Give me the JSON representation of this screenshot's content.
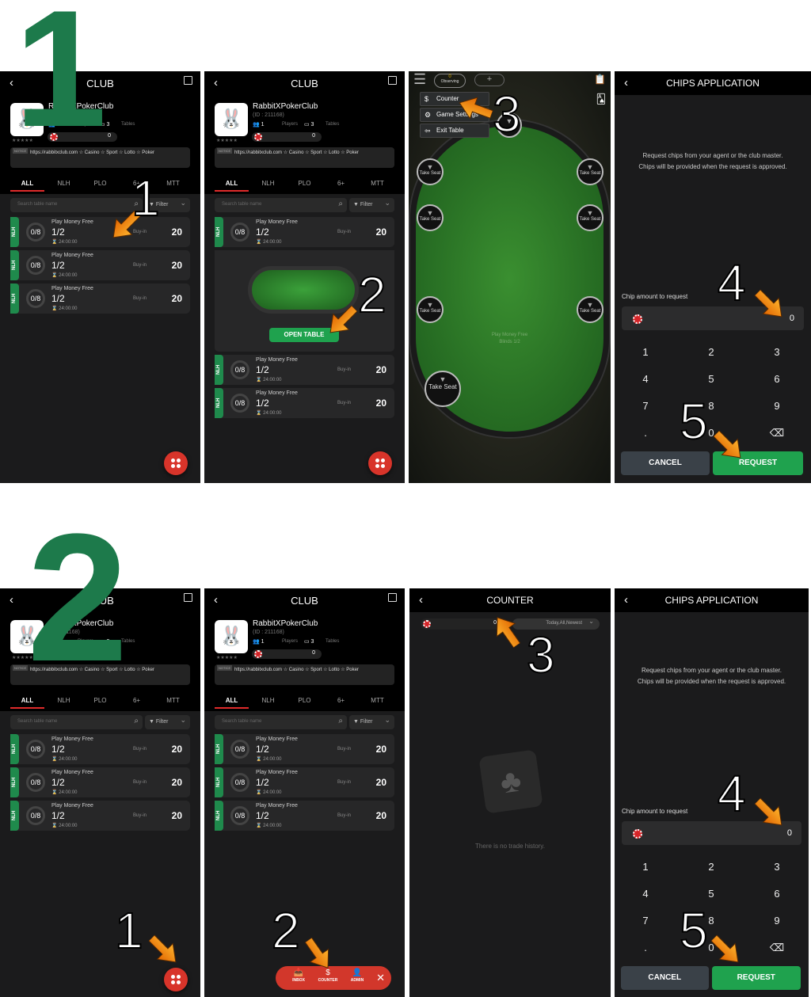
{
  "steps": {
    "section_one": "1",
    "section_two": "2"
  },
  "annotations": [
    "1",
    "2",
    "3",
    "4",
    "5"
  ],
  "colors": {
    "accent_green": "#1f8a4c",
    "accent_red": "#d8342a",
    "arrow_orange": "#f39200",
    "step_green": "#1d7a4b"
  },
  "club": {
    "title": "CLUB",
    "name": "RabbitXPokerClub",
    "id": "(ID : 211168)",
    "players_count": "1",
    "players_label": "Players",
    "tables_count": "3",
    "tables_label": "Tables",
    "chips": "0",
    "rating": "★★★★★",
    "notice_label": "NOTICE",
    "notice": "https://rabbitxclub.com ☆ Casino ☆ Sport ☆ Lotto ☆ Poker",
    "tabs": [
      "ALL",
      "NLH",
      "PLO",
      "6+",
      "MTT"
    ],
    "search_placeholder": "Search table name",
    "filter": "Filter",
    "open_table": "OPEN TABLE",
    "tables": [
      {
        "type": "NLH",
        "seats": "0/8",
        "name": "Play Money Free",
        "blinds": "1/2",
        "time": "24:00:00",
        "buyin_label": "Buy-in",
        "buyin": "20"
      },
      {
        "type": "NLH",
        "seats": "0/8",
        "name": "Play Money Free",
        "blinds": "1/2",
        "time": "24:00:00",
        "buyin_label": "Buy-in",
        "buyin": "20"
      },
      {
        "type": "NLH",
        "seats": "0/8",
        "name": "Play Money Free",
        "blinds": "1/2",
        "time": "24:00:00",
        "buyin_label": "Buy-in",
        "buyin": "20"
      }
    ]
  },
  "fab_menu": {
    "items": [
      "INBOX",
      "COUNTER",
      "ADMIN"
    ],
    "close": "✕"
  },
  "table_screen": {
    "observing_count": "0",
    "observing": "Observing",
    "add": "+",
    "menu": [
      "Counter",
      "Game Settings",
      "Exit Table"
    ],
    "take_seat": "Take Seat",
    "table_name": "Play Money Free",
    "blinds": "Blinds 1/2"
  },
  "chips": {
    "title": "CHIPS APPLICATION",
    "desc_line1": "Request chips from your agent or the club master.",
    "desc_line2": "Chips will be provided when the request is approved.",
    "amount_label": "Chip amount to request",
    "amount": "0",
    "keys": [
      "1",
      "2",
      "3",
      "4",
      "5",
      "6",
      "7",
      "8",
      "9",
      ".",
      "0",
      "⌫"
    ],
    "cancel": "CANCEL",
    "request": "REQUEST"
  },
  "counter": {
    "title": "COUNTER",
    "balance": "0",
    "filter": "Today,All,Newest",
    "empty": "There is no trade history."
  }
}
